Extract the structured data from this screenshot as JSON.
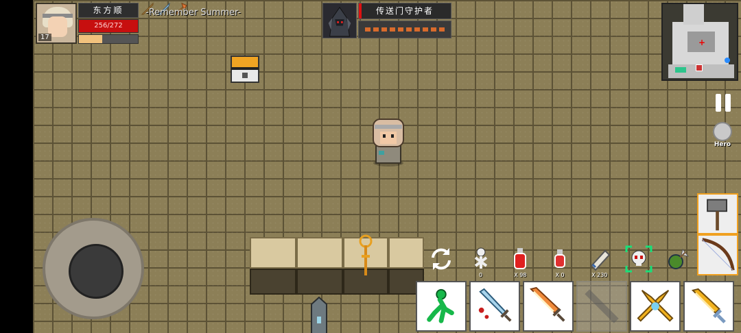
{
  "player": {
    "name": "东方顺",
    "level": "17",
    "hp_text": "256/272",
    "xp_fraction": 0.4,
    "nickname": "-Remember Summer-"
  },
  "buffs": [
    {
      "icon": "sword-buff-icon"
    },
    {
      "icon": "blade-buff-icon"
    },
    {
      "icon": "axe-buff-icon"
    }
  ],
  "boss": {
    "name": "传送门守护者",
    "hp_pips": 10
  },
  "minimap": {
    "label": "minimap"
  },
  "hero_button": {
    "label": "Hero"
  },
  "quickbar": [
    {
      "icon": "swap-icon",
      "count": ""
    },
    {
      "icon": "skeleton-icon",
      "count": "0"
    },
    {
      "icon": "red-potion-icon",
      "count": "X 98"
    },
    {
      "icon": "red-potion-small-icon",
      "count": "X 0"
    },
    {
      "icon": "scroll-icon",
      "count": "X 230"
    },
    {
      "icon": "skull-target-icon",
      "count": ""
    },
    {
      "icon": "grenade-icon",
      "count": ""
    }
  ],
  "skills": [
    {
      "icon": "dash-icon",
      "enabled": true
    },
    {
      "icon": "bleed-sword-icon",
      "enabled": true
    },
    {
      "icon": "flame-sword-icon",
      "enabled": true
    },
    {
      "icon": "disabled-skill-icon",
      "enabled": false
    },
    {
      "icon": "crossed-blades-icon",
      "enabled": true
    },
    {
      "icon": "golden-sword-icon",
      "enabled": true
    }
  ],
  "weapons": [
    {
      "icon": "hammer-icon"
    },
    {
      "icon": "bow-icon"
    }
  ]
}
